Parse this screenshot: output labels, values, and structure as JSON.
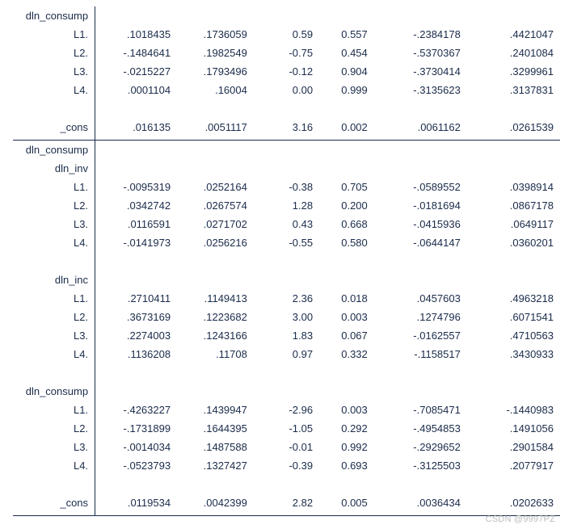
{
  "watermark": "CSDN @9997PZ",
  "colw": {
    "label": "15%",
    "c1": "15%",
    "c2": "14%",
    "c3": "12%",
    "c4": "10%",
    "c5": "17%",
    "c6": "17%"
  },
  "rows": [
    {
      "label": "dln_consump",
      "c": [
        "",
        "",
        "",
        "",
        "",
        ""
      ],
      "type": "hdr"
    },
    {
      "label": "L1.",
      "c": [
        ".1018435",
        ".1736059",
        "0.59",
        "0.557",
        "-.2384178",
        ".4421047"
      ]
    },
    {
      "label": "L2.",
      "c": [
        "-.1484641",
        ".1982549",
        "-0.75",
        "0.454",
        "-.5370367",
        ".2401084"
      ]
    },
    {
      "label": "L3.",
      "c": [
        "-.0215227",
        ".1793496",
        "-0.12",
        "0.904",
        "-.3730414",
        ".3299961"
      ]
    },
    {
      "label": "L4.",
      "c": [
        ".0001104",
        ".16004",
        "0.00",
        "0.999",
        "-.3135623",
        ".3137831"
      ]
    },
    {
      "type": "blank"
    },
    {
      "label": "_cons",
      "c": [
        ".016135",
        ".0051117",
        "3.16",
        "0.002",
        ".0061162",
        ".0261539"
      ]
    },
    {
      "type": "sep"
    },
    {
      "label": "dln_consump",
      "c": [
        "",
        "",
        "",
        "",
        "",
        ""
      ],
      "type": "hdr"
    },
    {
      "label": "dln_inv",
      "c": [
        "",
        "",
        "",
        "",
        "",
        ""
      ],
      "type": "hdr"
    },
    {
      "label": "L1.",
      "c": [
        "-.0095319",
        ".0252164",
        "-0.38",
        "0.705",
        "-.0589552",
        ".0398914"
      ]
    },
    {
      "label": "L2.",
      "c": [
        ".0342742",
        ".0267574",
        "1.28",
        "0.200",
        "-.0181694",
        ".0867178"
      ]
    },
    {
      "label": "L3.",
      "c": [
        ".0116591",
        ".0271702",
        "0.43",
        "0.668",
        "-.0415936",
        ".0649117"
      ]
    },
    {
      "label": "L4.",
      "c": [
        "-.0141973",
        ".0256216",
        "-0.55",
        "0.580",
        "-.0644147",
        ".0360201"
      ]
    },
    {
      "type": "blank"
    },
    {
      "label": "dln_inc",
      "c": [
        "",
        "",
        "",
        "",
        "",
        ""
      ],
      "type": "hdr"
    },
    {
      "label": "L1.",
      "c": [
        ".2710411",
        ".1149413",
        "2.36",
        "0.018",
        ".0457603",
        ".4963218"
      ]
    },
    {
      "label": "L2.",
      "c": [
        ".3673169",
        ".1223682",
        "3.00",
        "0.003",
        ".1274796",
        ".6071541"
      ]
    },
    {
      "label": "L3.",
      "c": [
        ".2274003",
        ".1243166",
        "1.83",
        "0.067",
        "-.0162557",
        ".4710563"
      ]
    },
    {
      "label": "L4.",
      "c": [
        ".1136208",
        ".11708",
        "0.97",
        "0.332",
        "-.1158517",
        ".3430933"
      ]
    },
    {
      "type": "blank"
    },
    {
      "label": "dln_consump",
      "c": [
        "",
        "",
        "",
        "",
        "",
        ""
      ],
      "type": "hdr"
    },
    {
      "label": "L1.",
      "c": [
        "-.4263227",
        ".1439947",
        "-2.96",
        "0.003",
        "-.7085471",
        "-.1440983"
      ]
    },
    {
      "label": "L2.",
      "c": [
        "-.1731899",
        ".1644395",
        "-1.05",
        "0.292",
        "-.4954853",
        ".1491056"
      ]
    },
    {
      "label": "L3.",
      "c": [
        "-.0014034",
        ".1487588",
        "-0.01",
        "0.992",
        "-.2929652",
        ".2901584"
      ]
    },
    {
      "label": "L4.",
      "c": [
        "-.0523793",
        ".1327427",
        "-0.39",
        "0.693",
        "-.3125503",
        ".2077917"
      ]
    },
    {
      "type": "blank"
    },
    {
      "label": "_cons",
      "c": [
        ".0119534",
        ".0042399",
        "2.82",
        "0.005",
        ".0036434",
        ".0202633"
      ]
    },
    {
      "type": "sep"
    }
  ]
}
